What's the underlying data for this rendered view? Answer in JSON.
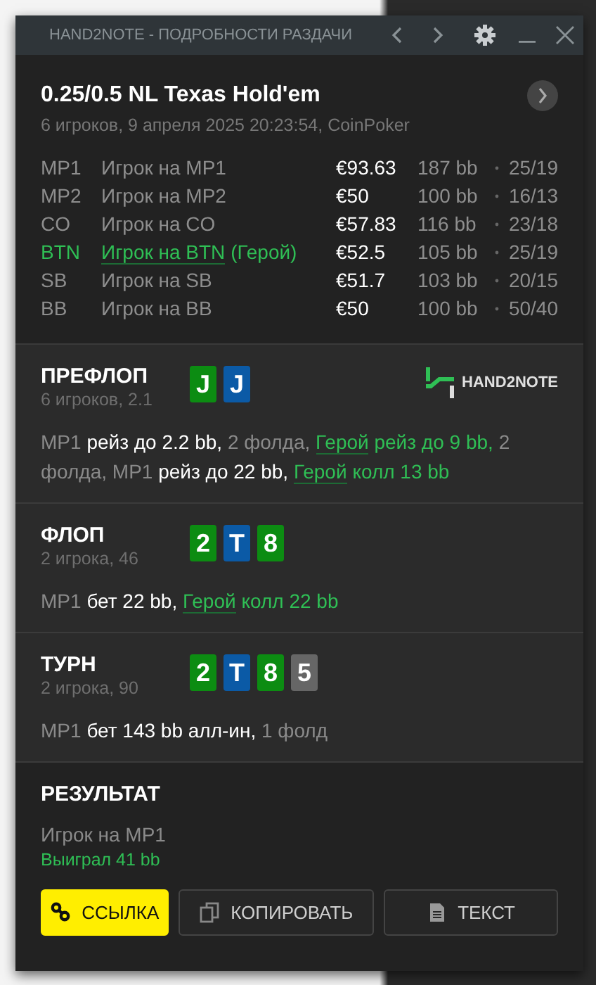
{
  "window": {
    "title": "HAND2NOTE - ПОДРОБНОСТИ РАЗДАЧИ"
  },
  "hand": {
    "title": "0.25/0.5 NL Texas Hold'em",
    "subtitle": "6 игроков, 9 апреля 2025 20:23:54, CoinPoker"
  },
  "players": [
    {
      "position": "MP1",
      "name": "Игрок на MP1",
      "hero": false,
      "stack": "€93.63",
      "bb": "187 bb",
      "stats": "25/19"
    },
    {
      "position": "MP2",
      "name": "Игрок на MP2",
      "hero": false,
      "stack": "€50",
      "bb": "100 bb",
      "stats": "16/13"
    },
    {
      "position": "CO",
      "name": "Игрок на CO",
      "hero": false,
      "stack": "€57.83",
      "bb": "116 bb",
      "stats": "23/18"
    },
    {
      "position": "BTN",
      "name": "Игрок на BTN",
      "hero_tag": "(Герой)",
      "hero": true,
      "stack": "€52.5",
      "bb": "105 bb",
      "stats": "25/19"
    },
    {
      "position": "SB",
      "name": "Игрок на SB",
      "hero": false,
      "stack": "€51.7",
      "bb": "103 bb",
      "stats": "20/15"
    },
    {
      "position": "BB",
      "name": "Игрок на BB",
      "hero": false,
      "stack": "€50",
      "bb": "100 bb",
      "stats": "50/40"
    }
  ],
  "streets": [
    {
      "name": "ПРЕФЛОП",
      "info": "6 игроков, 2.1",
      "logo": "HAND2NOTE",
      "cards": [
        {
          "rank": "J",
          "color": "#0c8c12"
        },
        {
          "rank": "J",
          "color": "#0b5aa6"
        }
      ],
      "actions": [
        {
          "text": "MP1",
          "kind": "player"
        },
        {
          "text": "рейз до 2.2 bb,",
          "kind": "action"
        },
        {
          "text": "2 фолда,",
          "kind": "player"
        },
        {
          "text": "Герой",
          "kind": "hero"
        },
        {
          "text": "рейз до 9 bb,",
          "kind": "hero_action"
        },
        {
          "text": "2 фолда,",
          "kind": "player"
        },
        {
          "text": "MP1",
          "kind": "player"
        },
        {
          "text": "рейз до 22 bb,",
          "kind": "action"
        },
        {
          "text": "Герой",
          "kind": "hero"
        },
        {
          "text": "колл 13 bb",
          "kind": "hero_action"
        }
      ]
    },
    {
      "name": "ФЛОП",
      "info": "2 игрока, 46",
      "cards": [
        {
          "rank": "2",
          "color": "#0c8c12"
        },
        {
          "rank": "T",
          "color": "#0b5aa6"
        },
        {
          "rank": "8",
          "color": "#0c8c12"
        }
      ],
      "actions": [
        {
          "text": "MP1",
          "kind": "player"
        },
        {
          "text": "бет 22 bb,",
          "kind": "action"
        },
        {
          "text": "Герой",
          "kind": "hero"
        },
        {
          "text": "колл 22 bb",
          "kind": "hero_action"
        }
      ]
    },
    {
      "name": "ТУРН",
      "info": "2 игрока, 90",
      "cards": [
        {
          "rank": "2",
          "color": "#0c8c12"
        },
        {
          "rank": "T",
          "color": "#0b5aa6"
        },
        {
          "rank": "8",
          "color": "#0c8c12"
        },
        {
          "rank": "5",
          "color": "#666666"
        }
      ],
      "actions": [
        {
          "text": "MP1",
          "kind": "player"
        },
        {
          "text": "бет 143 bb алл-ин,",
          "kind": "action"
        },
        {
          "text": "1 фолд",
          "kind": "player"
        }
      ]
    }
  ],
  "result": {
    "title": "РЕЗУЛЬТАТ",
    "player": "Игрок на MP1",
    "outcome": "Выиграл 41 bb"
  },
  "buttons": [
    {
      "label": "ССЫЛКА",
      "kind": "link"
    },
    {
      "label": "КОПИРОВАТЬ",
      "kind": "copy"
    },
    {
      "label": "ТЕКСТ",
      "kind": "text"
    }
  ]
}
